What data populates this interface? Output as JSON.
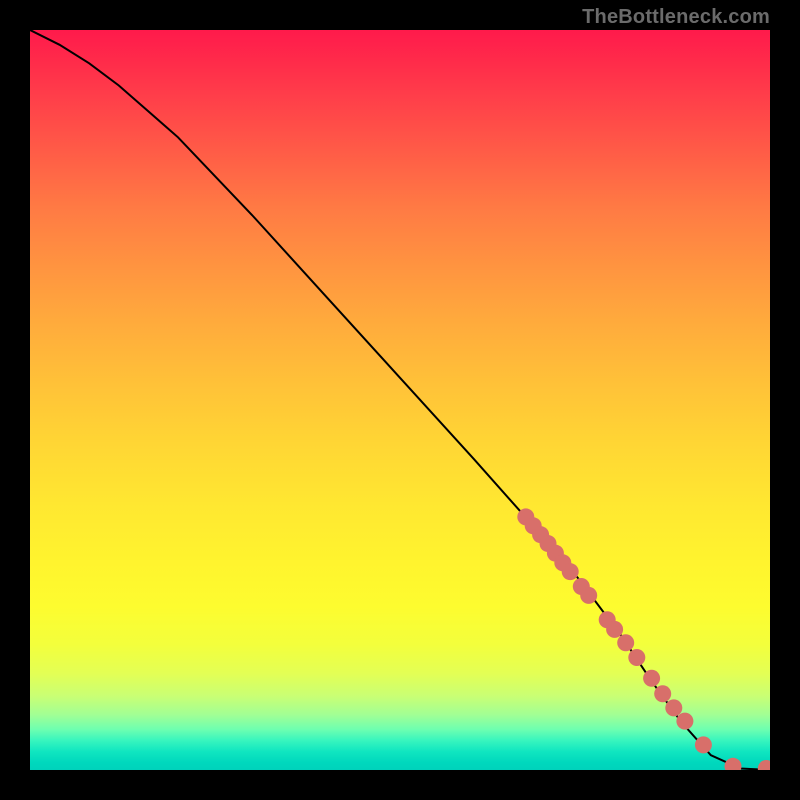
{
  "watermark": "TheBottleneck.com",
  "chart_data": {
    "type": "line",
    "title": "",
    "xlabel": "",
    "ylabel": "",
    "ylim": [
      0,
      100
    ],
    "xlim": [
      0,
      100
    ],
    "series": [
      {
        "name": "curve",
        "x": [
          0,
          4,
          8,
          12,
          16,
          20,
          30,
          40,
          50,
          60,
          68,
          74,
          80,
          84,
          88,
          92,
          96,
          100
        ],
        "y": [
          100,
          98,
          95.5,
          92.5,
          89,
          85.5,
          75,
          64,
          53,
          42,
          33,
          26,
          18,
          12,
          6.5,
          2,
          0.2,
          0
        ]
      },
      {
        "name": "markers",
        "type": "scatter",
        "x": [
          67,
          68,
          69,
          70,
          71,
          72,
          73,
          74.5,
          75.5,
          78,
          79,
          80.5,
          82,
          84,
          85.5,
          87,
          88.5,
          91,
          95,
          99.5
        ],
        "y": [
          34.2,
          33,
          31.8,
          30.6,
          29.3,
          28,
          26.8,
          24.8,
          23.6,
          20.3,
          19,
          17.2,
          15.2,
          12.4,
          10.3,
          8.4,
          6.6,
          3.4,
          0.5,
          0.2
        ]
      }
    ],
    "colors": {
      "curve": "#000000",
      "marker_fill": "#d86f6a",
      "marker_stroke": "#b95550"
    }
  }
}
